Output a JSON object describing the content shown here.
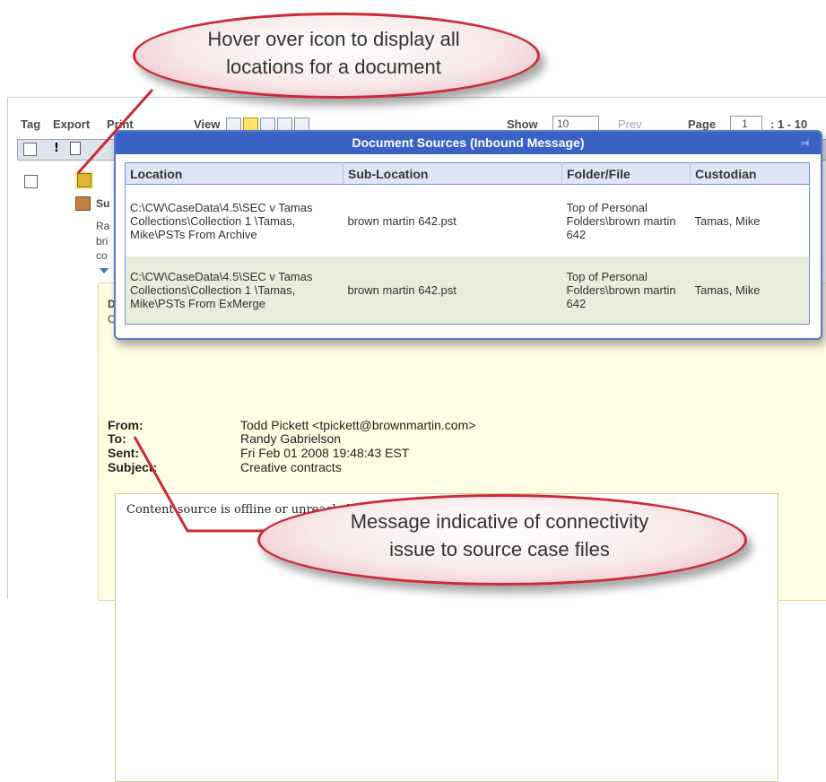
{
  "toolbar": {
    "tag": "Tag",
    "export": "Export",
    "print": "Print",
    "view": "View",
    "show": "Show",
    "show_value": "10",
    "prev": "Prev",
    "page": "Page",
    "page_value": "1",
    "range": ": 1 - 10"
  },
  "grid": {
    "header_excl": "!",
    "row_fragments": [
      "Su",
      "Ra",
      "bri",
      "co",
      "D",
      "C"
    ]
  },
  "preview": {
    "headers": [
      {
        "label": "From:",
        "value": "Todd Pickett <tpickett@brownmartin.com>"
      },
      {
        "label": "To:",
        "value": "Randy Gabrielson"
      },
      {
        "label": "Sent:",
        "value": "Fri Feb 01 2008 19:48:43 EST"
      },
      {
        "label": "Subject:",
        "value": "Creative contracts"
      }
    ],
    "content_message": "Content source is offline or unreachable"
  },
  "popup": {
    "title": "Document Sources (Inbound Message)",
    "columns": [
      "Location",
      "Sub-Location",
      "Folder/File",
      "Custodian"
    ],
    "rows": [
      {
        "location": "C:\\CW\\CaseData\\4.5\\SEC v Tamas Collections\\Collection 1 \\Tamas, Mike\\PSTs From Archive",
        "sub_location": "brown martin 642.pst",
        "folder_file": "Top of Personal Folders\\brown martin 642",
        "custodian": "Tamas, Mike"
      },
      {
        "location": "C:\\CW\\CaseData\\4.5\\SEC v Tamas Collections\\Collection 1 \\Tamas, Mike\\PSTs From ExMerge",
        "sub_location": "brown martin 642.pst",
        "folder_file": "Top of Personal Folders\\brown martin 642",
        "custodian": "Tamas, Mike"
      }
    ]
  },
  "callouts": {
    "top": [
      "Hover over icon to display all",
      "locations for a document"
    ],
    "bottom": [
      "Message indicative of connectivity",
      "issue to source case files"
    ]
  },
  "colors": {
    "popup_header": "#3a62c4",
    "callout_border": "#cc2a35",
    "preview_bg": "#fffde4"
  }
}
